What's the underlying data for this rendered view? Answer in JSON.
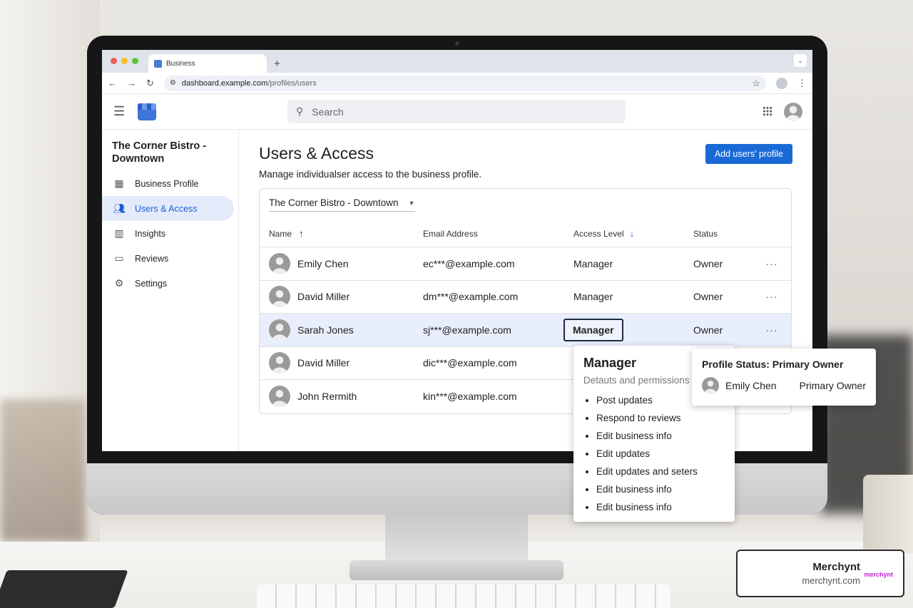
{
  "browser": {
    "tab_title": "Business",
    "new_tab_symbol": "+",
    "url_domain": "dashboard.example.com",
    "url_path": "/profiles/users"
  },
  "appbar": {
    "search_placeholder": "Search"
  },
  "sidebar": {
    "business_name": "The Corner Bistro - Downtown",
    "items": [
      {
        "label": "Business Profile",
        "icon": "storefront-icon"
      },
      {
        "label": "Users & Access",
        "icon": "people-icon",
        "active": true
      },
      {
        "label": "Insights",
        "icon": "bar-chart-icon"
      },
      {
        "label": "Reviews",
        "icon": "comment-icon"
      },
      {
        "label": "Settings",
        "icon": "gear-icon"
      }
    ]
  },
  "main": {
    "title": "Users & Access",
    "subtitle": "Manage individualser access to the business profile.",
    "add_button": "Add users' profile",
    "location_select": "The Corner Bistro - Downtown",
    "columns": {
      "name": "Name",
      "email": "Email Address",
      "access": "Access Level",
      "status": "Status"
    },
    "rows": [
      {
        "name": "Emily Chen",
        "email": "ec***@example.com",
        "access": "Manager",
        "status": "Owner"
      },
      {
        "name": "David Miller",
        "email": "dm***@example.com",
        "access": "Manager",
        "status": "Owner"
      },
      {
        "name": "Sarah Jones",
        "email": "sj***@example.com",
        "access": "Manager",
        "status": "Owner",
        "selected": true
      },
      {
        "name": "David Miller",
        "email": "dic***@example.com",
        "access": "",
        "status": ""
      },
      {
        "name": "John Rermith",
        "email": "kin***@example.com",
        "access": "",
        "status": ""
      }
    ],
    "more_symbol": "···"
  },
  "permissions_popover": {
    "title": "Manager",
    "subtitle": "Detauts and permissions",
    "items": [
      "Post updates",
      "Respond to reviews",
      "Edit business info",
      "Edit updates",
      "Edit updates and seters",
      "Edit business info",
      "Edit business info"
    ]
  },
  "status_popover": {
    "title": "Profile Status: Primary Owner",
    "user": "Emily Chen",
    "role": "Primary Owner"
  },
  "brand_badge": {
    "name": "Merchynt",
    "url": "merchynt.com",
    "mark": "merchynt"
  },
  "colors": {
    "accent": "#1a6ad6",
    "active_nav_bg": "#e3ebfb",
    "selected_row_bg": "#e8eefb",
    "brand_mark": "#c21fd6"
  }
}
